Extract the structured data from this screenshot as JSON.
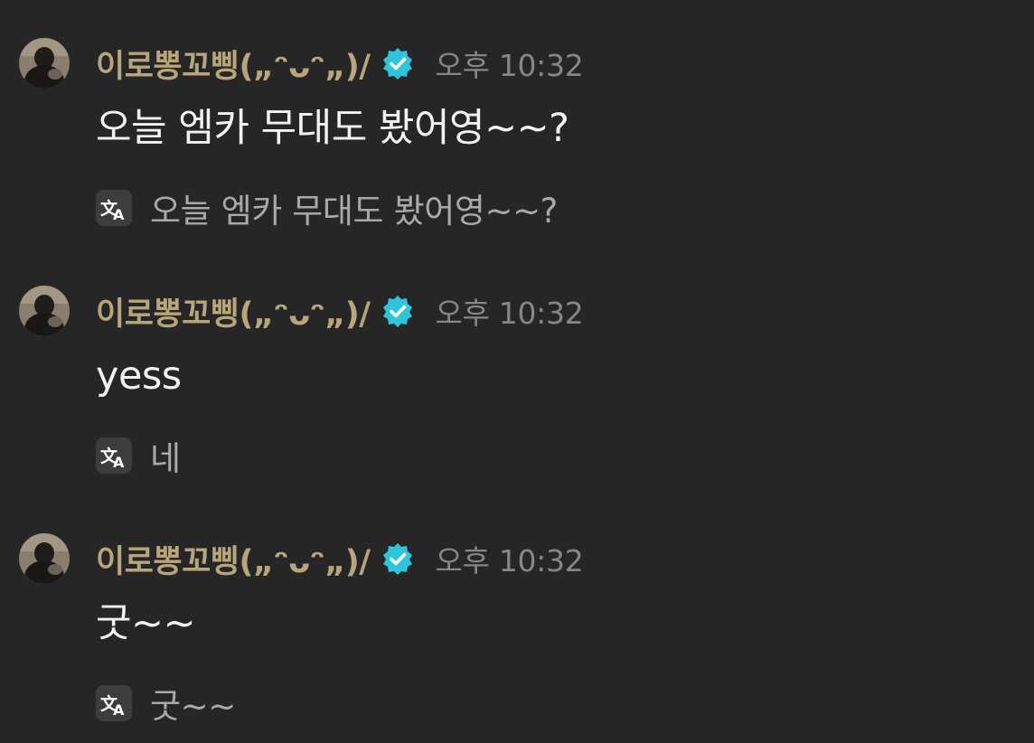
{
  "messages": [
    {
      "author": "이로뽕꼬삥(„ᵔᴗᵔ„)/",
      "timestamp": "오후 10:32",
      "text": "오늘 엠카 무대도 봤어영~~?",
      "translation": "오늘 엠카 무대도 봤어영~~?"
    },
    {
      "author": "이로뽕꼬삥(„ᵔᴗᵔ„)/",
      "timestamp": "오후 10:32",
      "text": "yess",
      "translation": "네"
    },
    {
      "author": "이로뽕꼬삥(„ᵔᴗᵔ„)/",
      "timestamp": "오후 10:32",
      "text": "굿~~",
      "translation": "굿~~"
    }
  ],
  "icons": {
    "verified": "verified-badge-icon",
    "translate": "translate-icon",
    "avatar": "user-avatar"
  },
  "colors": {
    "background": "#262626",
    "author_name": "#b8a57c",
    "verified_badge": "#2ec4dc",
    "timestamp": "#868686",
    "message_text": "#f2f2f2",
    "translation_text": "#a9a9a9"
  }
}
